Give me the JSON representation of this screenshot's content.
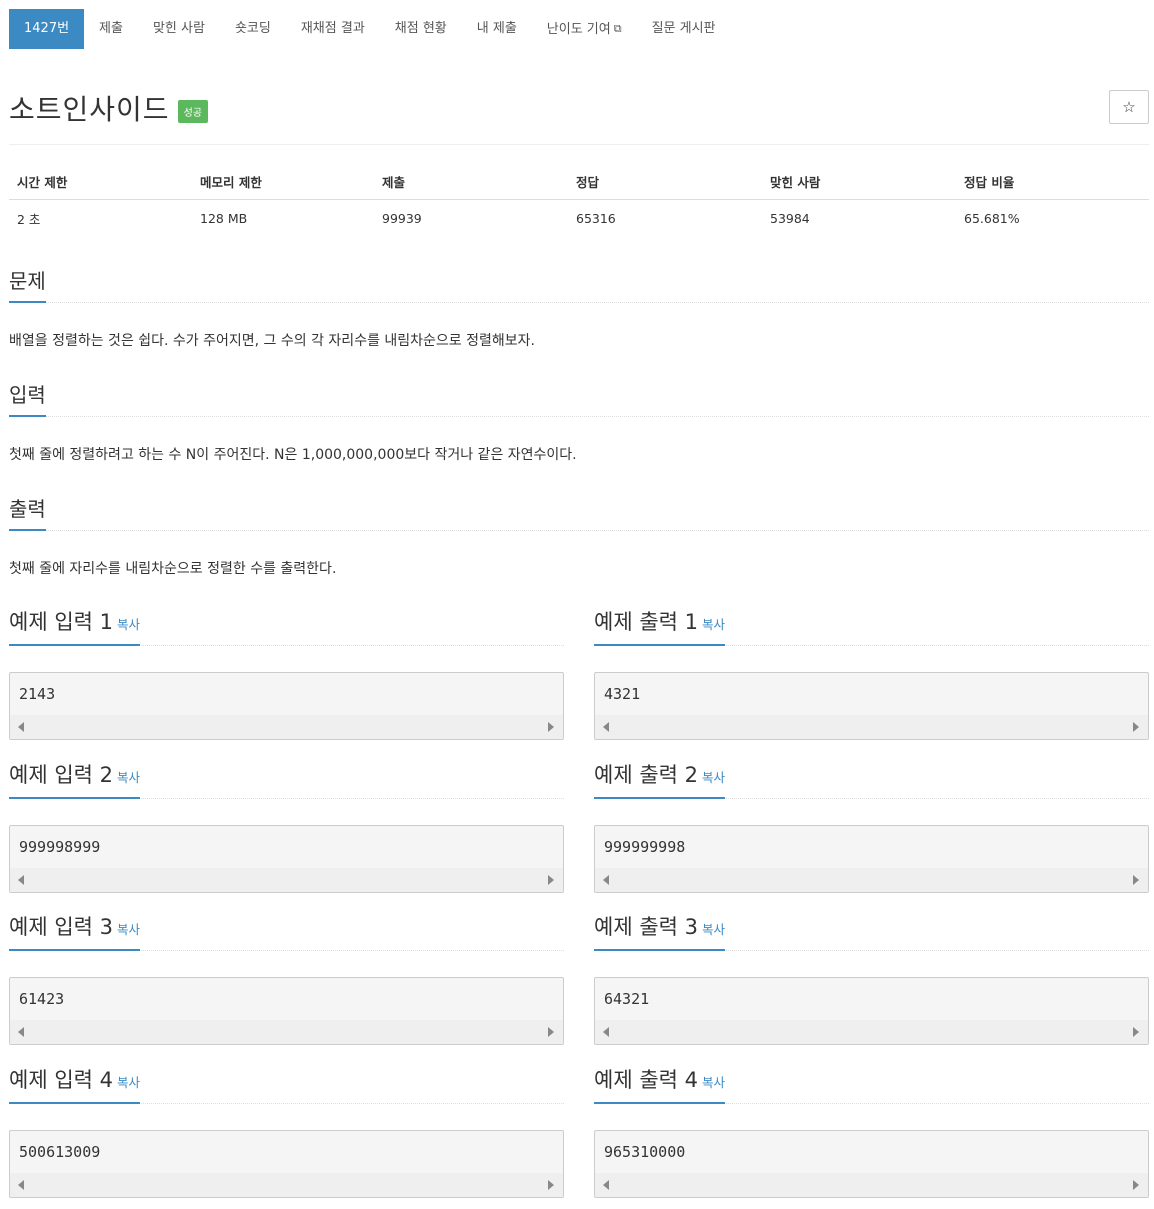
{
  "tabs": [
    {
      "label": "1427번"
    },
    {
      "label": "제출"
    },
    {
      "label": "맞힌 사람"
    },
    {
      "label": "숏코딩"
    },
    {
      "label": "재채점 결과"
    },
    {
      "label": "채점 현황"
    },
    {
      "label": "내 제출"
    },
    {
      "label": "난이도 기여"
    },
    {
      "label": "질문 게시판"
    }
  ],
  "problem": {
    "title": "소트인사이드",
    "badge": "성공",
    "star": "☆"
  },
  "stats": {
    "headers": [
      "시간 제한",
      "메모리 제한",
      "제출",
      "정답",
      "맞힌 사람",
      "정답 비율"
    ],
    "values": [
      "2 초",
      "128 MB",
      "99939",
      "65316",
      "53984",
      "65.681%"
    ]
  },
  "sections": {
    "description": {
      "title": "문제",
      "text": "배열을 정렬하는 것은 쉽다. 수가 주어지면, 그 수의 각 자리수를 내림차순으로 정렬해보자."
    },
    "input": {
      "title": "입력",
      "text": "첫째 줄에 정렬하려고 하는 수 N이 주어진다. N은 1,000,000,000보다 작거나 같은 자연수이다."
    },
    "output": {
      "title": "출력",
      "text": "첫째 줄에 자리수를 내림차순으로 정렬한 수를 출력한다."
    }
  },
  "copy_label": "복사",
  "samples": [
    {
      "in_title": "예제 입력 1",
      "in": "2143",
      "out_title": "예제 출력 1",
      "out": "4321"
    },
    {
      "in_title": "예제 입력 2",
      "in": "999998999",
      "out_title": "예제 출력 2",
      "out": "999999998"
    },
    {
      "in_title": "예제 입력 3",
      "in": "61423",
      "out_title": "예제 출력 3",
      "out": "64321"
    },
    {
      "in_title": "예제 입력 4",
      "in": "500613009",
      "out_title": "예제 출력 4",
      "out": "965310000"
    }
  ],
  "colors": {
    "accent": "#3b8ac4",
    "success": "#5cb85c"
  }
}
